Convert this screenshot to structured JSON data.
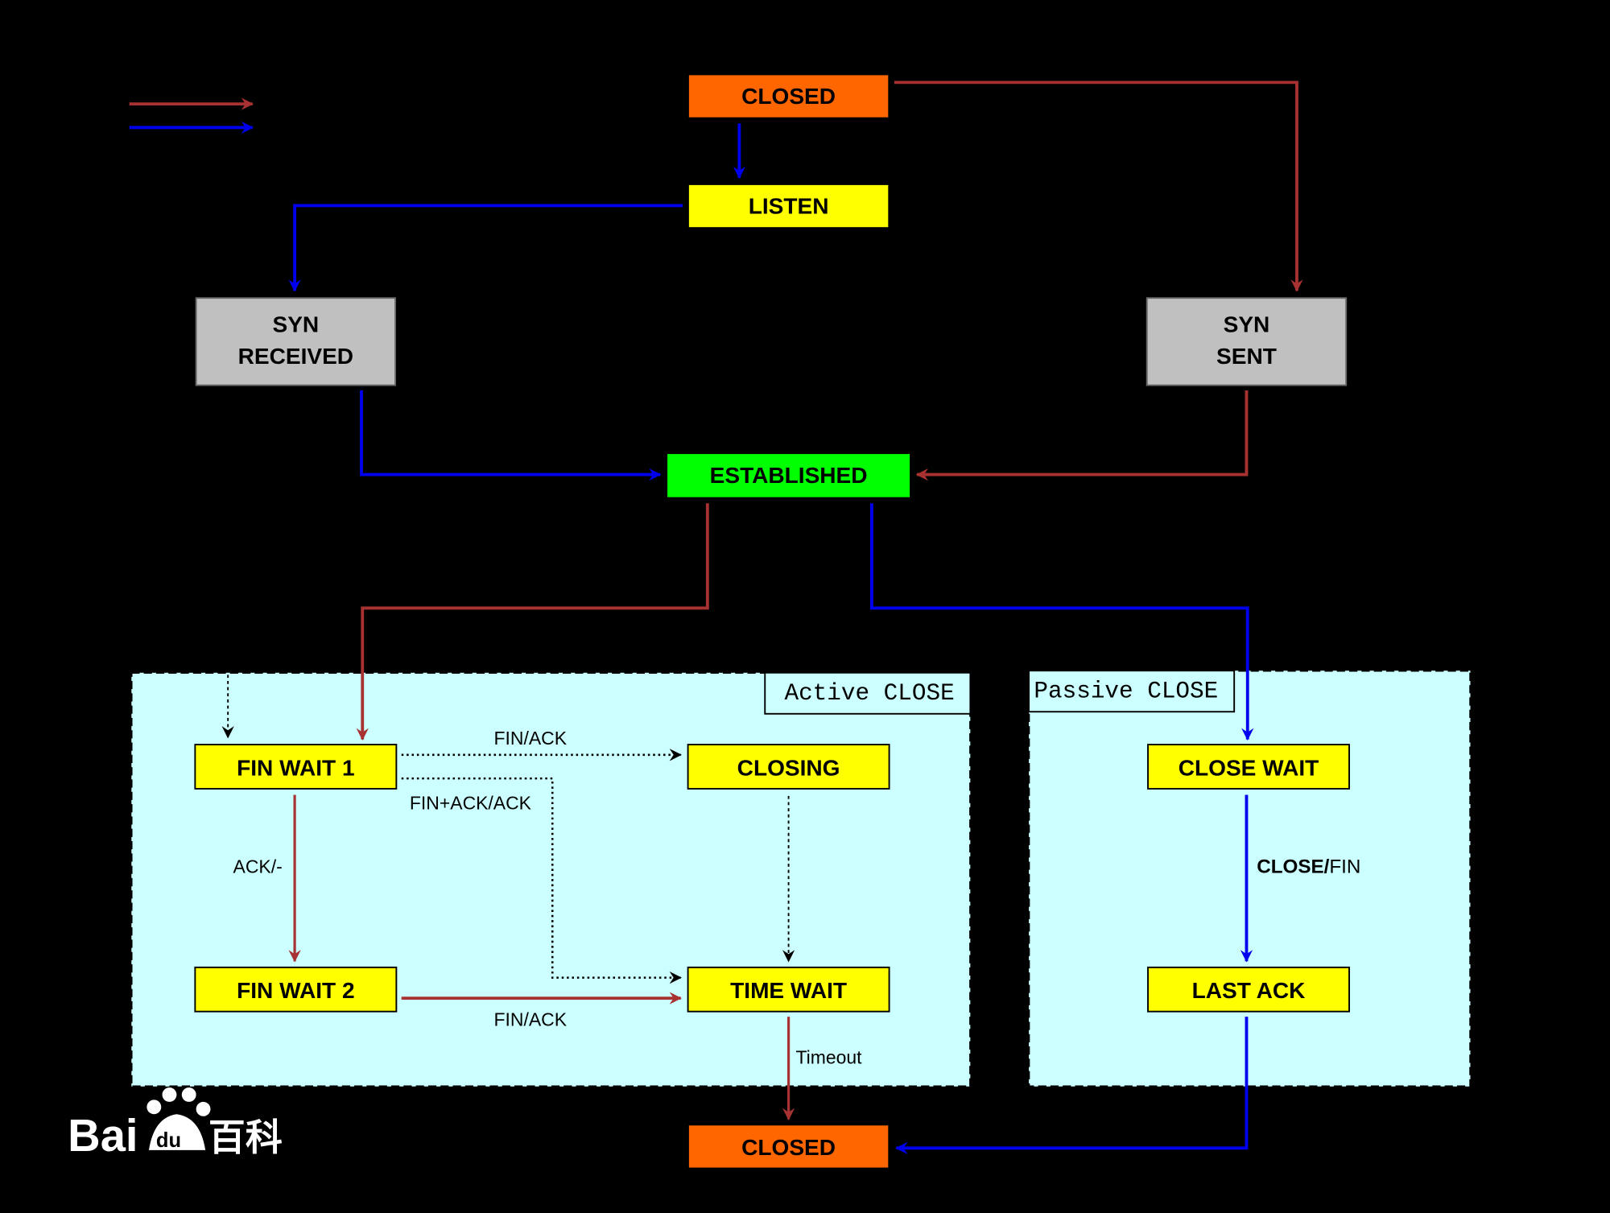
{
  "colors": {
    "active_path": "#a83232",
    "passive_path": "#0000ee",
    "closed": "#ff6600",
    "listen": "#ffff00",
    "syn": "#c0c0c0",
    "established": "#00ff00",
    "region": "#ccffff"
  },
  "states": {
    "closed_top": "CLOSED",
    "listen": "LISTEN",
    "syn_received_1": "SYN",
    "syn_received_2": "RECEIVED",
    "syn_sent_1": "SYN",
    "syn_sent_2": "SENT",
    "established": "ESTABLISHED",
    "fin_wait_1": "FIN WAIT 1",
    "closing": "CLOSING",
    "fin_wait_2": "FIN WAIT 2",
    "time_wait": "TIME WAIT",
    "close_wait": "CLOSE WAIT",
    "last_ack": "LAST ACK",
    "closed_bottom": "CLOSED"
  },
  "regions": {
    "active": "Active CLOSE",
    "passive": "Passive CLOSE"
  },
  "transitions": {
    "fw1_closing": "FIN/ACK",
    "fw1_timewait": "FIN+ACK/ACK",
    "fw1_fw2": "ACK/-",
    "fw2_timewait": "FIN/ACK",
    "timeout": "Timeout",
    "close_bold": "CLOSE/",
    "close_fin": "FIN"
  },
  "watermark": {
    "text": "Bai du 百科"
  }
}
